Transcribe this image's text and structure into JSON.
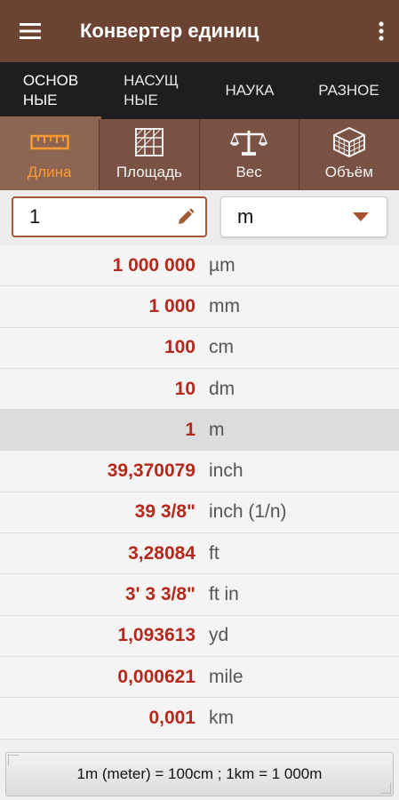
{
  "appbar": {
    "title": "Конвертер единиц",
    "menu_icon": "hamburger-menu-icon",
    "more_icon": "more-vert-icon"
  },
  "tabs": [
    {
      "line1": "ОСНОВ",
      "line2": "НЫЕ",
      "active": true
    },
    {
      "line1": "НАСУЩ",
      "line2": "НЫЕ",
      "active": false
    },
    {
      "line1": "НАУКА",
      "line2": "",
      "active": false
    },
    {
      "line1": "РАЗНОЕ",
      "line2": "",
      "active": false
    }
  ],
  "categories": [
    {
      "label": "Длина",
      "icon": "ruler-icon",
      "active": true
    },
    {
      "label": "Площадь",
      "icon": "area-grid-icon",
      "active": false
    },
    {
      "label": "Вес",
      "icon": "scales-icon",
      "active": false
    },
    {
      "label": "Объём",
      "icon": "cube-icon",
      "active": false
    }
  ],
  "input": {
    "value": "1",
    "unit": "m",
    "edit_icon": "pencil-icon",
    "dropdown_icon": "caret-down-icon"
  },
  "results": [
    {
      "value": "1 000 000",
      "unit": "µm"
    },
    {
      "value": "1 000",
      "unit": "mm"
    },
    {
      "value": "100",
      "unit": "cm"
    },
    {
      "value": "10",
      "unit": "dm"
    },
    {
      "value": "1",
      "unit": "m",
      "selected": true
    },
    {
      "value": "39,370079",
      "unit": "inch"
    },
    {
      "value": "39 3/8\"",
      "unit": "inch (1/n)"
    },
    {
      "value": "3,28084",
      "unit": "ft"
    },
    {
      "value": "3' 3 3/8\"",
      "unit": "ft in"
    },
    {
      "value": "1,093613",
      "unit": "yd"
    },
    {
      "value": "0,000621",
      "unit": "mile"
    },
    {
      "value": "0,001",
      "unit": "km"
    }
  ],
  "footer": {
    "text": "1m (meter) = 100cm ; 1km = 1 000m"
  },
  "colors": {
    "appbar": "#6b4332",
    "tabbar": "#1e1e1e",
    "category_bar": "#7a5243",
    "active_category_text": "#ff9a32",
    "value_text": "#b5281c"
  }
}
